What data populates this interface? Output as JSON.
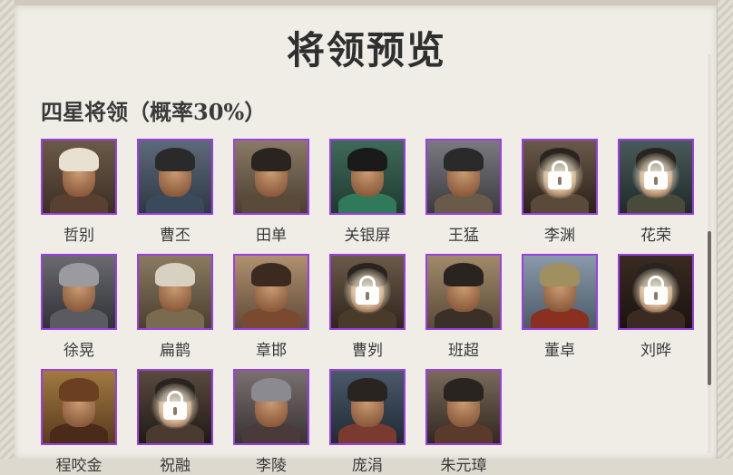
{
  "title": "将领预览",
  "section": {
    "title": "四星将领（概率30%）"
  },
  "generals": [
    {
      "name": "哲别",
      "locked": false
    },
    {
      "name": "曹丕",
      "locked": false
    },
    {
      "name": "田单",
      "locked": false
    },
    {
      "name": "关银屏",
      "locked": false
    },
    {
      "name": "王猛",
      "locked": false
    },
    {
      "name": "李渊",
      "locked": true
    },
    {
      "name": "花荣",
      "locked": true
    },
    {
      "name": "徐晃",
      "locked": false
    },
    {
      "name": "扁鹊",
      "locked": false
    },
    {
      "name": "章邯",
      "locked": false
    },
    {
      "name": "曹刿",
      "locked": true
    },
    {
      "name": "班超",
      "locked": false
    },
    {
      "name": "董卓",
      "locked": false
    },
    {
      "name": "刘晔",
      "locked": true
    },
    {
      "name": "程咬金",
      "locked": false
    },
    {
      "name": "祝融",
      "locked": true
    },
    {
      "name": "李陵",
      "locked": false
    },
    {
      "name": "庞涓",
      "locked": false
    },
    {
      "name": "朱元璋",
      "locked": false
    }
  ],
  "colors": {
    "frame_border": "#9b3fe0",
    "title_text": "#2f2f2f"
  }
}
